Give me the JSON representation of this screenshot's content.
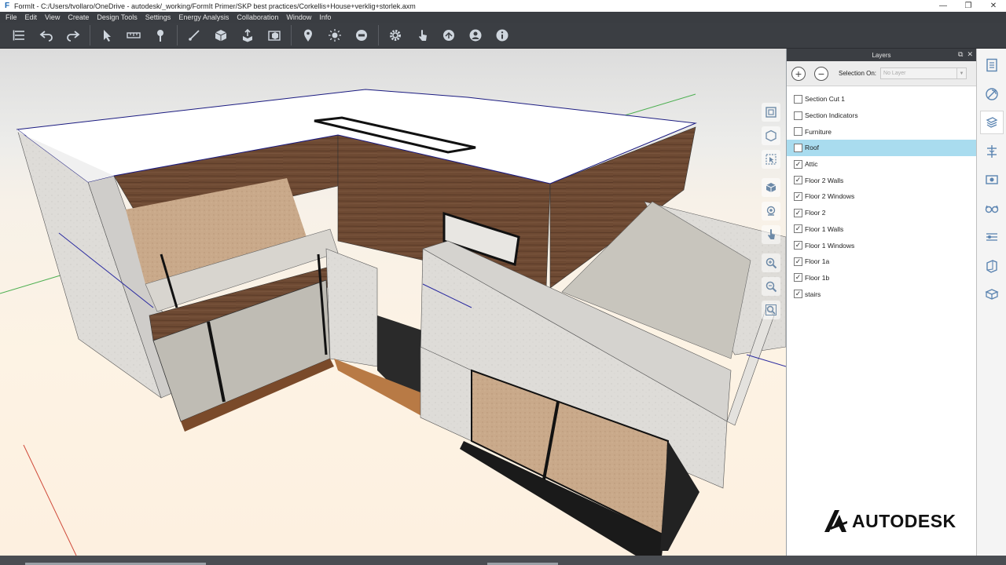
{
  "window": {
    "app_icon": "F",
    "title": "FormIt - C:/Users/tvollaro/OneDrive - autodesk/_working/FormIt Primer/SKP best practices/Corkellis+House+verklig+storlek.axm",
    "minimize": "—",
    "restore": "❐",
    "close": "✕"
  },
  "menu": [
    {
      "label": "File"
    },
    {
      "label": "Edit"
    },
    {
      "label": "View"
    },
    {
      "label": "Create"
    },
    {
      "label": "Design Tools"
    },
    {
      "label": "Settings"
    },
    {
      "label": "Energy Analysis"
    },
    {
      "label": "Collaboration"
    },
    {
      "label": "Window"
    },
    {
      "label": "Info"
    }
  ],
  "toolbar_icons": [
    "list-icon",
    "undo-icon",
    "redo-icon",
    "select-icon",
    "measure-icon",
    "paint-icon",
    "line-icon",
    "cube-icon",
    "push-pull-icon",
    "group-icon",
    "location-icon",
    "sun-icon",
    "level-icon",
    "settings-icon",
    "touch-icon",
    "share-icon",
    "user-icon",
    "info-icon"
  ],
  "layers_panel": {
    "title": "Layers",
    "header_controls": {
      "float": "⧉",
      "close": "✕"
    },
    "add_label": "+",
    "remove_label": "−",
    "selection_on_label": "Selection On:",
    "selection_on_value": "No Layer",
    "layers": [
      {
        "name": "Section Cut  1",
        "checked": false,
        "selected": false
      },
      {
        "name": "Section Indicators",
        "checked": false,
        "selected": false
      },
      {
        "name": "Furniture",
        "checked": false,
        "selected": false
      },
      {
        "name": "Roof",
        "checked": false,
        "selected": true
      },
      {
        "name": "Attic",
        "checked": true,
        "selected": false
      },
      {
        "name": "Floor 2 Walls",
        "checked": true,
        "selected": false
      },
      {
        "name": "Floor 2 Windows",
        "checked": true,
        "selected": false
      },
      {
        "name": "Floor 2",
        "checked": true,
        "selected": false
      },
      {
        "name": "Floor 1 Walls",
        "checked": true,
        "selected": false
      },
      {
        "name": "Floor 1 Windows",
        "checked": true,
        "selected": false
      },
      {
        "name": "Floor 1a",
        "checked": true,
        "selected": false
      },
      {
        "name": "Floor 1b",
        "checked": true,
        "selected": false
      },
      {
        "name": "stairs",
        "checked": true,
        "selected": false
      }
    ]
  },
  "logo": {
    "text": "AUTODESK"
  },
  "right_strip_icons": [
    "properties-icon",
    "materials-icon",
    "layers-icon",
    "levels-icon",
    "scenes-icon",
    "glasses-icon",
    "groups-icon",
    "content-icon",
    "sketch-icon"
  ],
  "nav_icons": [
    "zoom-extents-icon",
    "view-cube-icon",
    "zoom-selected-icon",
    "orbit-icon",
    "look-icon",
    "pan-icon",
    "zoom-in-icon",
    "zoom-out-icon",
    "zoom-window-icon"
  ],
  "colors": {
    "accent": "#a9dcef",
    "chrome": "#3b3e43",
    "icon": "#cfd6de"
  }
}
